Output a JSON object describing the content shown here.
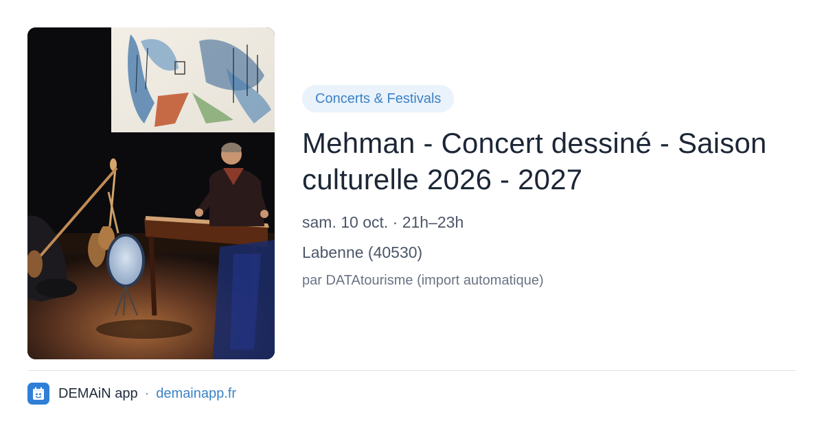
{
  "event": {
    "category": "Concerts & Festivals",
    "title": "Mehman - Concert dessiné - Saison culturelle 2026 - 2027",
    "datetime": "sam. 10 oct. · 21h–23h",
    "location": "Labenne (40530)",
    "source": "par DATAtourisme (import automatique)"
  },
  "footer": {
    "app_name": "DEMAiN app",
    "separator": "·",
    "domain": "demainapp.fr"
  },
  "icons": {
    "logo": "demain-app-logo-icon"
  },
  "colors": {
    "accent": "#3b82c4",
    "category_bg": "#eaf2fb",
    "logo_bg": "#2f7fd6"
  }
}
